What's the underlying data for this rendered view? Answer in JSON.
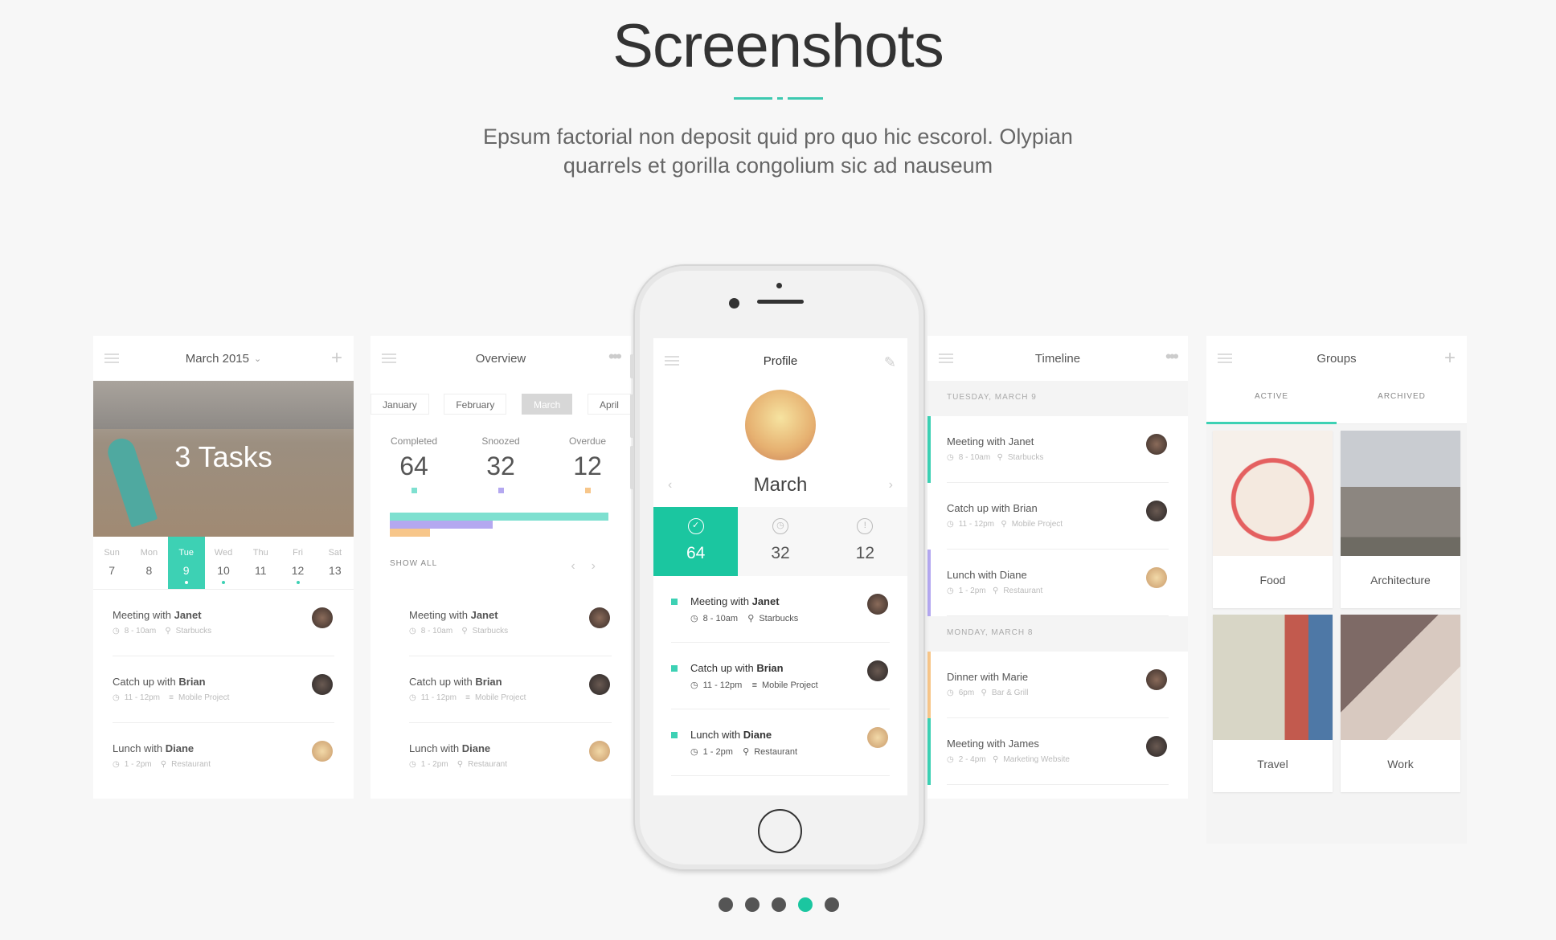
{
  "header": {
    "title": "Screenshots",
    "subtitle": "Epsum factorial non deposit quid pro quo hic escorol. Olypian quarrels et gorilla congolium sic ad nauseum"
  },
  "colors": {
    "accent": "#3dd1b4",
    "completed": "#7ee0d0",
    "snoozed": "#b4a8f0",
    "overdue": "#f7c68a"
  },
  "calendar": {
    "title": "March 2015",
    "hero_text": "3 Tasks",
    "days": [
      {
        "n": "Sun",
        "v": "7"
      },
      {
        "n": "Mon",
        "v": "8"
      },
      {
        "n": "Tue",
        "v": "9"
      },
      {
        "n": "Wed",
        "v": "10"
      },
      {
        "n": "Thu",
        "v": "11"
      },
      {
        "n": "Fri",
        "v": "12"
      },
      {
        "n": "Sat",
        "v": "13"
      }
    ],
    "selected_day": "Tue"
  },
  "events": [
    {
      "who": "Meeting with ",
      "name": "Janet",
      "time": "8 - 10am",
      "place": "Starbucks"
    },
    {
      "who": "Catch up with ",
      "name": "Brian",
      "time": "11 - 12pm",
      "place": "Mobile Project"
    },
    {
      "who": "Lunch with ",
      "name": "Diane",
      "time": "1 - 2pm",
      "place": "Restaurant"
    }
  ],
  "overview": {
    "title": "Overview",
    "months": [
      "January",
      "February",
      "March",
      "April"
    ],
    "active_month": "March",
    "stats": [
      {
        "label": "Completed",
        "value": "64"
      },
      {
        "label": "Snoozed",
        "value": "32"
      },
      {
        "label": "Overdue",
        "value": "12"
      }
    ],
    "show_all": "SHOW ALL"
  },
  "profile": {
    "title": "Profile",
    "month": "March",
    "stats": [
      "64",
      "32",
      "12"
    ]
  },
  "timeline": {
    "title": "Timeline",
    "sections": [
      {
        "label": "TUESDAY, MARCH 9",
        "events": [
          {
            "t": "Meeting with Janet",
            "time": "8 - 10am",
            "place": "Starbucks",
            "bar": "#3dd1b4"
          },
          {
            "t": "Catch up with Brian",
            "time": "11 - 12pm",
            "place": "Mobile Project",
            "bar": "#ffffff"
          },
          {
            "t": "Lunch with Diane",
            "time": "1 - 2pm",
            "place": "Restaurant",
            "bar": "#b4a8f0"
          }
        ]
      },
      {
        "label": "MONDAY, MARCH 8",
        "events": [
          {
            "t": "Dinner with Marie",
            "time": "6pm",
            "place": "Bar & Grill",
            "bar": "#f7c68a"
          },
          {
            "t": "Meeting with James",
            "time": "2 - 4pm",
            "place": "Marketing Website",
            "bar": "#3dd1b4"
          }
        ]
      }
    ]
  },
  "groups": {
    "title": "Groups",
    "tabs": [
      "ACTIVE",
      "ARCHIVED"
    ],
    "cards": [
      "Food",
      "Architecture",
      "Travel",
      "Work"
    ]
  },
  "pager": {
    "count": 5,
    "active": 4
  }
}
